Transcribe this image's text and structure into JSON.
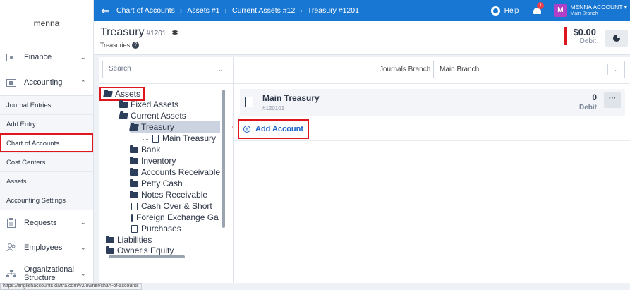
{
  "brand": "menna",
  "sidebar": {
    "finance": "Finance",
    "accounting": "Accounting",
    "sub_items": [
      "Journal Entries",
      "Add Entry",
      "Chart of Accounts",
      "Cost Centers",
      "Assets",
      "Accounting Settings"
    ],
    "requests": "Requests",
    "employees": "Employees",
    "org_structure_1": "Organizational",
    "org_structure_2": "Structure"
  },
  "topbar": {
    "crumbs": [
      "Chart of Accounts",
      "Assets #1",
      "Current Assets #12",
      "Treasury #1201"
    ],
    "help": "Help",
    "notif_count": "1",
    "avatar_letter": "M",
    "account_name": "MENNA ACCOUNT",
    "account_branch": "Main Branch"
  },
  "header": {
    "title": "Treasury",
    "code": "#1201",
    "subtitle": "Treasuries",
    "balance_amount": "$0.00",
    "balance_label": "Debit"
  },
  "tree": {
    "search_placeholder": "Search",
    "nodes": {
      "assets": "Assets",
      "fixed_assets": "Fixed Assets",
      "current_assets": "Current Assets",
      "treasury": "Treasury",
      "main_treasury": "Main Treasury",
      "bank": "Bank",
      "inventory": "Inventory",
      "accounts_receivable": "Accounts Receivable",
      "petty_cash": "Petty Cash",
      "notes_receivable": "Notes Receivable",
      "cash_over_short": "Cash Over & Short",
      "fx_gains": "Foreign Exchange Gains",
      "purchases": "Purchases",
      "liabilities": "Liabilities",
      "owners_equity": "Owner's Equity"
    }
  },
  "main": {
    "journals_branch_label": "Journals Branch",
    "journals_branch_value": "Main Branch",
    "account": {
      "name": "Main Treasury",
      "code": "#120101",
      "value": "0",
      "value_label": "Debit",
      "more": "···"
    },
    "add_account": "Add Account"
  },
  "status_url": "https://englishaccounts.daftra.com/v2/owner/chart-of-accounts"
}
